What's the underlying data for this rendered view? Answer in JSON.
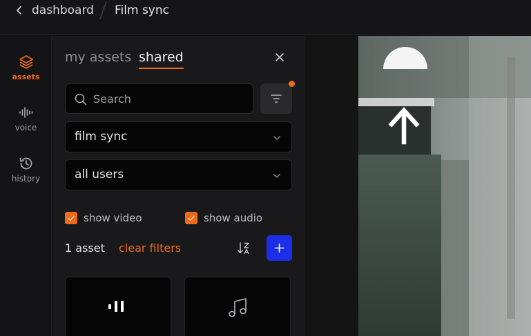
{
  "header": {
    "breadcrumb_root": "dashboard",
    "breadcrumb_current": "Film sync"
  },
  "rail": {
    "items": [
      {
        "label": "assets",
        "icon": "layers-icon",
        "active": true
      },
      {
        "label": "voice",
        "icon": "waveform-icon",
        "active": false
      },
      {
        "label": "history",
        "icon": "history-icon",
        "active": false
      }
    ]
  },
  "panel": {
    "tabs": [
      {
        "label": "my assets",
        "active": false
      },
      {
        "label": "shared",
        "active": true
      }
    ],
    "search": {
      "placeholder": "Search",
      "value": ""
    },
    "filters": {
      "project_select": "film sync",
      "user_select": "all users",
      "show_video_label": "show video",
      "show_video_checked": true,
      "show_audio_label": "show audio",
      "show_audio_checked": true,
      "has_active_filters": true
    },
    "result_count": "1 asset",
    "clear_filters_label": "clear filters",
    "cards": [
      {
        "icon": "audio-bars-icon"
      },
      {
        "icon": "music-note-icon"
      }
    ]
  },
  "colors": {
    "accent": "#ee6a1a",
    "primary_button": "#1d2ee8",
    "background": "#121214",
    "panel": "#19191b"
  }
}
